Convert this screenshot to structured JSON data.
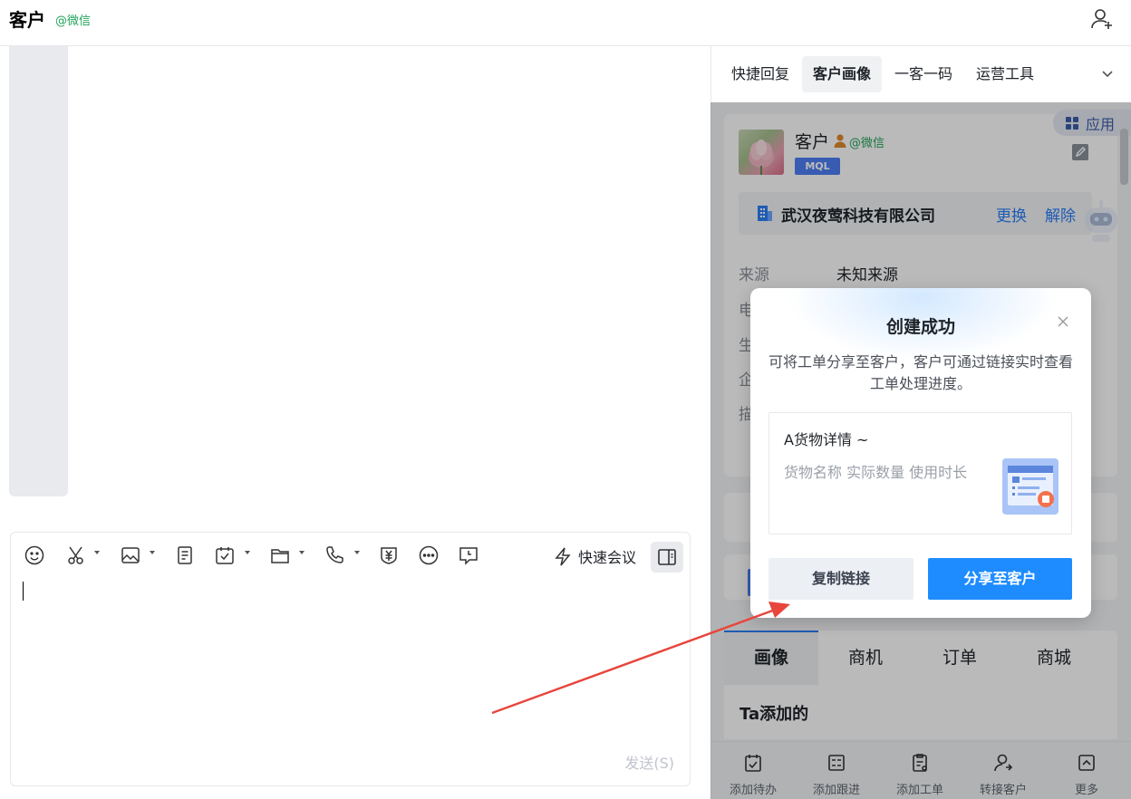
{
  "header": {
    "title": "客户",
    "channel": "@微信"
  },
  "editor": {
    "quick_meeting": "快速会议",
    "send_label": "发送(S)"
  },
  "right_panel": {
    "tabs": [
      "快捷回复",
      "客户画像",
      "一客一码",
      "运营工具"
    ],
    "active_tab": "客户画像",
    "app_badge": "应用",
    "customer": {
      "name": "客户",
      "channel": "@微信",
      "tag": "MQL",
      "company": "武汉夜莺科技有限公司",
      "change_label": "更换",
      "unbind_label": "解除",
      "fields": [
        {
          "label": "来源",
          "value": "未知来源"
        },
        {
          "label": "电",
          "value": ""
        },
        {
          "label": "生",
          "value": ""
        },
        {
          "label": "企",
          "value": ""
        },
        {
          "label": "描",
          "value": ""
        }
      ]
    },
    "profile_tabs": [
      "画像",
      "商机",
      "订单",
      "商城"
    ],
    "added_by_title": "Ta添加的",
    "actions": [
      "添加待办",
      "添加跟进",
      "添加工单",
      "转接客户",
      "更多"
    ]
  },
  "modal": {
    "title": "创建成功",
    "description": "可将工单分享至客户，客户可通过链接实时查看工单处理进度。",
    "ticket_title": "A货物详情 ~",
    "ticket_fields": "货物名称 实际数量 使用时长",
    "copy_link": "复制链接",
    "share_to_customer": "分享至客户"
  },
  "colors": {
    "accent_blue": "#1e8cff",
    "link_blue": "#2b7ef6",
    "wechat_green": "#22a45a",
    "annotation_red": "#e8453c"
  }
}
